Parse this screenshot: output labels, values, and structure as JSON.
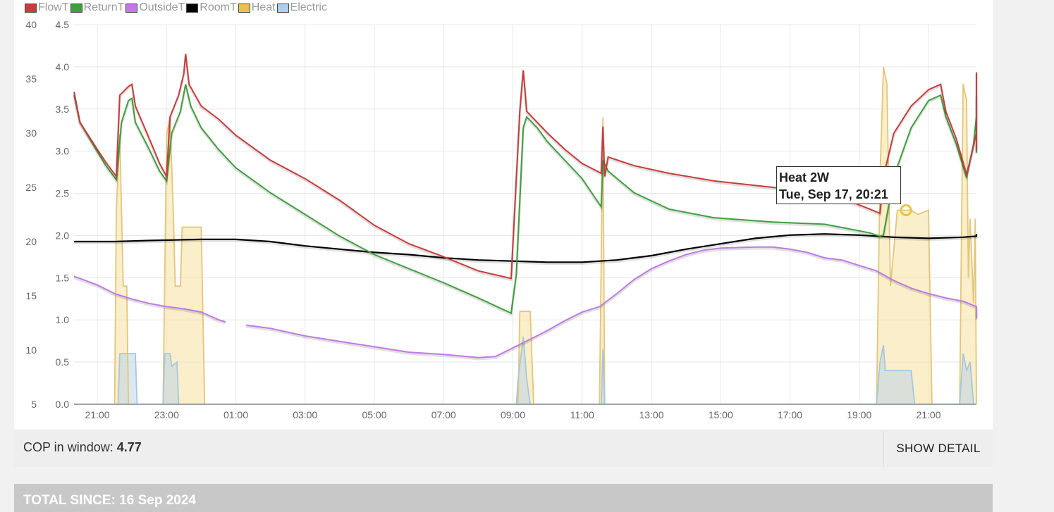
{
  "legend": [
    {
      "name": "FlowT",
      "color": "#c83c3c"
    },
    {
      "name": "ReturnT",
      "color": "#3ea03e"
    },
    {
      "name": "OutsideT",
      "color": "#c07ae6"
    },
    {
      "name": "RoomT",
      "color": "#000000"
    },
    {
      "name": "Heat",
      "color": "#e8c24a"
    },
    {
      "name": "Electric",
      "color": "#a8d2f0"
    }
  ],
  "chart_data": {
    "type": "line",
    "x_tick_labels": [
      "21:00",
      "23:00",
      "01:00",
      "03:00",
      "05:00",
      "07:00",
      "09:00",
      "11:00",
      "13:00",
      "15:00",
      "17:00",
      "19:00",
      "21:00"
    ],
    "y_left_ticks": [
      "5",
      "10",
      "15",
      "20",
      "25",
      "30",
      "35",
      "40"
    ],
    "y_right_ticks": [
      "0.0",
      "0.5",
      "1.0",
      "1.5",
      "2.0",
      "2.5",
      "3.0",
      "3.5",
      "4.0",
      "4.5"
    ],
    "ylim_left": [
      5,
      40
    ],
    "ylim_right": [
      0,
      4.5
    ],
    "xlim_hours": [
      20.3,
      46.4
    ],
    "grid": true,
    "series": [
      {
        "name": "FlowT",
        "axis": "left",
        "color": "#c83c3c",
        "points": [
          [
            20.33,
            33.8
          ],
          [
            20.5,
            31.0
          ],
          [
            21.0,
            28.5
          ],
          [
            21.25,
            27.3
          ],
          [
            21.55,
            26.0
          ],
          [
            21.65,
            33.5
          ],
          [
            21.9,
            34.3
          ],
          [
            22.0,
            34.5
          ],
          [
            22.1,
            32.5
          ],
          [
            22.5,
            29.5
          ],
          [
            22.8,
            27.2
          ],
          [
            23.0,
            26.0
          ],
          [
            23.1,
            31.5
          ],
          [
            23.35,
            33.5
          ],
          [
            23.5,
            35.5
          ],
          [
            23.55,
            37.3
          ],
          [
            23.65,
            34.5
          ],
          [
            24.0,
            32.5
          ],
          [
            24.5,
            31.3
          ],
          [
            25.0,
            29.8
          ],
          [
            26.0,
            27.5
          ],
          [
            27.0,
            25.8
          ],
          [
            28.0,
            23.8
          ],
          [
            29.0,
            21.5
          ],
          [
            30.0,
            19.8
          ],
          [
            31.0,
            18.6
          ],
          [
            32.0,
            17.3
          ],
          [
            32.95,
            16.6
          ],
          [
            33.2,
            32.0
          ],
          [
            33.3,
            35.8
          ],
          [
            33.4,
            32.0
          ],
          [
            34.0,
            30.0
          ],
          [
            34.5,
            28.5
          ],
          [
            35.0,
            27.2
          ],
          [
            35.55,
            26.3
          ],
          [
            35.6,
            30.6
          ],
          [
            35.65,
            26.0
          ],
          [
            35.75,
            27.8
          ],
          [
            36.5,
            27.0
          ],
          [
            37.5,
            26.3
          ],
          [
            38.8,
            25.6
          ],
          [
            40.5,
            25.0
          ],
          [
            42.0,
            24.4
          ],
          [
            42.5,
            24.0
          ],
          [
            43.3,
            23.0
          ],
          [
            43.6,
            22.6
          ],
          [
            43.7,
            26.0
          ],
          [
            44.0,
            30.0
          ],
          [
            44.5,
            32.5
          ],
          [
            45.0,
            34.0
          ],
          [
            45.35,
            34.5
          ],
          [
            45.5,
            32.0
          ],
          [
            45.8,
            29.5
          ],
          [
            46.1,
            26.2
          ],
          [
            46.2,
            27.5
          ],
          [
            46.5,
            30.0
          ],
          [
            46.75,
            31.5
          ],
          [
            46.82,
            35.6
          ],
          [
            47.0,
            32.0
          ],
          [
            47.5,
            30.0
          ],
          [
            47.8,
            28.5
          ]
        ]
      },
      {
        "name": "ReturnT",
        "axis": "left",
        "color": "#3ea03e",
        "points": [
          [
            20.33,
            33.5
          ],
          [
            20.5,
            31.0
          ],
          [
            21.0,
            28.3
          ],
          [
            21.25,
            27.0
          ],
          [
            21.55,
            25.7
          ],
          [
            21.7,
            31.0
          ],
          [
            21.9,
            33.0
          ],
          [
            22.0,
            33.2
          ],
          [
            22.1,
            31.0
          ],
          [
            22.5,
            28.5
          ],
          [
            22.8,
            26.5
          ],
          [
            23.0,
            25.6
          ],
          [
            23.15,
            30.0
          ],
          [
            23.4,
            32.0
          ],
          [
            23.55,
            34.5
          ],
          [
            23.7,
            32.5
          ],
          [
            24.0,
            30.5
          ],
          [
            24.5,
            28.5
          ],
          [
            25.0,
            26.8
          ],
          [
            26.0,
            24.5
          ],
          [
            27.0,
            22.5
          ],
          [
            28.0,
            20.5
          ],
          [
            29.0,
            18.8
          ],
          [
            30.0,
            17.5
          ],
          [
            31.0,
            16.2
          ],
          [
            32.0,
            14.8
          ],
          [
            32.95,
            13.4
          ],
          [
            33.1,
            17.0
          ],
          [
            33.3,
            30.5
          ],
          [
            33.4,
            31.5
          ],
          [
            33.7,
            30.5
          ],
          [
            34.0,
            29.2
          ],
          [
            34.5,
            27.5
          ],
          [
            35.0,
            25.8
          ],
          [
            35.55,
            23.2
          ],
          [
            35.6,
            27.5
          ],
          [
            35.75,
            26.5
          ],
          [
            36.5,
            24.5
          ],
          [
            37.5,
            23.0
          ],
          [
            38.8,
            22.2
          ],
          [
            40.5,
            21.8
          ],
          [
            42.0,
            21.6
          ],
          [
            42.5,
            21.3
          ],
          [
            43.3,
            20.8
          ],
          [
            43.6,
            20.5
          ],
          [
            43.7,
            20.6
          ],
          [
            44.0,
            26.0
          ],
          [
            44.5,
            30.5
          ],
          [
            45.0,
            33.0
          ],
          [
            45.35,
            33.5
          ],
          [
            45.5,
            31.5
          ],
          [
            45.8,
            29.0
          ],
          [
            46.1,
            25.9
          ],
          [
            46.3,
            29.0
          ],
          [
            46.6,
            31.5
          ],
          [
            46.82,
            33.5
          ],
          [
            47.0,
            31.5
          ],
          [
            47.5,
            29.0
          ],
          [
            47.8,
            28.2
          ]
        ]
      },
      {
        "name": "OutsideT",
        "axis": "left",
        "color": "#c07ae6",
        "points": [
          [
            20.33,
            16.8
          ],
          [
            21.0,
            16.0
          ],
          [
            21.5,
            15.2
          ],
          [
            22.0,
            14.7
          ],
          [
            22.5,
            14.3
          ],
          [
            23.0,
            14.0
          ],
          [
            23.5,
            13.8
          ],
          [
            24.0,
            13.5
          ],
          [
            24.5,
            12.8
          ],
          [
            24.7,
            12.6
          ],
          [
            null,
            null
          ],
          [
            25.3,
            12.3
          ],
          [
            26.0,
            12.0
          ],
          [
            27.0,
            11.3
          ],
          [
            28.0,
            10.8
          ],
          [
            29.0,
            10.3
          ],
          [
            30.0,
            9.8
          ],
          [
            31.0,
            9.6
          ],
          [
            32.0,
            9.3
          ],
          [
            32.5,
            9.4
          ],
          [
            33.0,
            10.2
          ],
          [
            33.5,
            11.0
          ],
          [
            34.0,
            11.8
          ],
          [
            34.5,
            12.7
          ],
          [
            35.0,
            13.5
          ],
          [
            35.5,
            14.0
          ],
          [
            36.0,
            15.2
          ],
          [
            36.5,
            16.5
          ],
          [
            37.0,
            17.5
          ],
          [
            37.5,
            18.2
          ],
          [
            38.0,
            18.8
          ],
          [
            38.5,
            19.2
          ],
          [
            39.0,
            19.4
          ],
          [
            40.0,
            19.5
          ],
          [
            40.5,
            19.5
          ],
          [
            41.0,
            19.3
          ],
          [
            41.5,
            19.0
          ],
          [
            42.0,
            18.5
          ],
          [
            42.5,
            18.3
          ],
          [
            43.0,
            17.8
          ],
          [
            43.5,
            17.3
          ],
          [
            44.0,
            16.4
          ],
          [
            44.5,
            15.7
          ],
          [
            45.0,
            15.2
          ],
          [
            45.5,
            14.8
          ],
          [
            46.0,
            14.5
          ],
          [
            46.5,
            14.0
          ],
          [
            47.0,
            13.6
          ],
          [
            47.5,
            13.3
          ],
          [
            47.8,
            12.9
          ]
        ]
      },
      {
        "name": "RoomT",
        "axis": "left",
        "color": "#000000",
        "points": [
          [
            20.33,
            20.0
          ],
          [
            21.5,
            20.0
          ],
          [
            22.5,
            20.1
          ],
          [
            24.0,
            20.2
          ],
          [
            25.0,
            20.2
          ],
          [
            26.0,
            20.0
          ],
          [
            27.0,
            19.6
          ],
          [
            28.0,
            19.3
          ],
          [
            29.0,
            19.0
          ],
          [
            30.0,
            18.8
          ],
          [
            31.0,
            18.5
          ],
          [
            32.0,
            18.3
          ],
          [
            33.0,
            18.2
          ],
          [
            34.0,
            18.1
          ],
          [
            35.0,
            18.1
          ],
          [
            36.0,
            18.3
          ],
          [
            37.0,
            18.7
          ],
          [
            38.0,
            19.3
          ],
          [
            39.0,
            19.8
          ],
          [
            40.0,
            20.3
          ],
          [
            41.0,
            20.6
          ],
          [
            42.0,
            20.7
          ],
          [
            43.0,
            20.6
          ],
          [
            44.0,
            20.4
          ],
          [
            45.0,
            20.3
          ],
          [
            46.0,
            20.4
          ],
          [
            47.0,
            20.5
          ],
          [
            47.8,
            20.7
          ]
        ]
      },
      {
        "name": "Heat",
        "axis": "right",
        "color": "#e8c24a",
        "points": [
          [
            20.33,
            0.0
          ],
          [
            21.5,
            0.0
          ],
          [
            21.55,
            2.3
          ],
          [
            21.65,
            3.2
          ],
          [
            21.75,
            1.4
          ],
          [
            21.85,
            1.4
          ],
          [
            21.9,
            0.0
          ],
          [
            22.9,
            0.0
          ],
          [
            23.0,
            3.2
          ],
          [
            23.1,
            3.4
          ],
          [
            23.2,
            2.2
          ],
          [
            23.25,
            1.4
          ],
          [
            23.4,
            1.4
          ],
          [
            23.45,
            2.1
          ],
          [
            23.7,
            2.1
          ],
          [
            24.0,
            2.1
          ],
          [
            24.1,
            0.0
          ],
          [
            24.5,
            0.0
          ],
          [
            33.15,
            0.0
          ],
          [
            33.2,
            1.1
          ],
          [
            33.5,
            1.1
          ],
          [
            33.6,
            0.0
          ],
          [
            35.5,
            0.0
          ],
          [
            35.6,
            3.4
          ],
          [
            35.65,
            0.0
          ],
          [
            43.5,
            0.0
          ],
          [
            43.6,
            2.7
          ],
          [
            43.7,
            4.0
          ],
          [
            43.8,
            3.8
          ],
          [
            43.9,
            1.4
          ],
          [
            44.1,
            2.3
          ],
          [
            44.5,
            2.3
          ],
          [
            44.7,
            2.25
          ],
          [
            45.0,
            2.3
          ],
          [
            45.1,
            0.0
          ],
          [
            45.9,
            0.0
          ],
          [
            46.0,
            3.8
          ],
          [
            46.1,
            3.6
          ],
          [
            46.15,
            1.5
          ],
          [
            46.2,
            2.2
          ],
          [
            46.3,
            1.2
          ],
          [
            46.35,
            2.2
          ],
          [
            46.4,
            0.0
          ],
          [
            47.8,
            0.0
          ]
        ]
      },
      {
        "name": "Electric",
        "axis": "right",
        "color": "#a8d2f0",
        "points": [
          [
            20.33,
            0.0
          ],
          [
            21.6,
            0.0
          ],
          [
            21.65,
            0.6
          ],
          [
            22.1,
            0.6
          ],
          [
            22.15,
            0.0
          ],
          [
            22.9,
            0.0
          ],
          [
            22.95,
            0.6
          ],
          [
            23.1,
            0.6
          ],
          [
            23.15,
            0.45
          ],
          [
            23.3,
            0.5
          ],
          [
            23.35,
            0.0
          ],
          [
            33.1,
            0.0
          ],
          [
            33.15,
            0.3
          ],
          [
            33.3,
            0.8
          ],
          [
            33.4,
            0.3
          ],
          [
            33.5,
            0.0
          ],
          [
            35.55,
            0.0
          ],
          [
            35.6,
            0.65
          ],
          [
            35.65,
            0.0
          ],
          [
            43.5,
            0.0
          ],
          [
            43.6,
            0.5
          ],
          [
            43.7,
            0.7
          ],
          [
            43.75,
            0.4
          ],
          [
            44.5,
            0.4
          ],
          [
            44.6,
            0.0
          ],
          [
            45.9,
            0.0
          ],
          [
            46.0,
            0.6
          ],
          [
            46.1,
            0.4
          ],
          [
            46.2,
            0.5
          ],
          [
            46.3,
            0.0
          ],
          [
            47.8,
            0.0
          ]
        ]
      }
    ]
  },
  "tooltip": {
    "line1": "Heat 2W",
    "line2": "Tue, Sep 17, 20:21"
  },
  "cop": {
    "label": "COP in window: ",
    "value": "4.77",
    "button": "SHOW DETAIL"
  },
  "total": {
    "label": "TOTAL SINCE: 16 Sep 2024"
  }
}
